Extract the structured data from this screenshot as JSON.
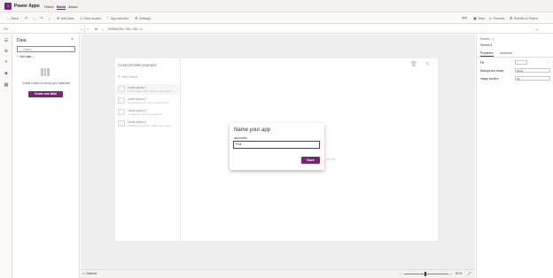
{
  "app": {
    "title": "Power Apps",
    "logo_glyph": "›"
  },
  "topnav": {
    "home": "Home",
    "build": "Build",
    "about": "About"
  },
  "cmdbar": {
    "back": "Back",
    "add_data": "Add data",
    "new_screen": "New screen",
    "app_checker": "App checker",
    "settings": "Settings",
    "app": "App",
    "save": "Save",
    "preview": "Preview",
    "publish": "Publish to Teams"
  },
  "formula": {
    "property": "Fill",
    "fx": "fx",
    "expression": "RGBA(255, 255, 255, 1)"
  },
  "data_panel": {
    "title": "Data",
    "search_placeholder": "Search",
    "add_data": "Add data",
    "empty_message": "Create a table to set up your database",
    "create_button": "Create new table"
  },
  "canvas": {
    "gallery_title": "CustomGallerySample",
    "new_record": "New record",
    "items": [
      {
        "title": "Lorem ipsum 1",
        "subtitle": "Lorem ipsum dolor sit amet, consectetur"
      },
      {
        "title": "Lorem ipsum 2",
        "subtitle": "Suspendisse elit metus, tincidunt quis"
      },
      {
        "title": "Lorem ipsum 3",
        "subtitle": "Ut pharetra a dolor ac vehicula"
      },
      {
        "title": "Lorem ipsum 4",
        "subtitle": "Vestibulum leo felis, fringilla nec et velit"
      }
    ],
    "hidden_text": "this list"
  },
  "right_panel": {
    "screen_label": "Screen",
    "screen_name": "Screen1",
    "tab_properties": "Properties",
    "tab_advanced": "Advanced",
    "fill_label": "Fill",
    "bg_image_label": "Background image",
    "bg_image_value": "None",
    "image_position_label": "Image position",
    "image_position_value": "Fit"
  },
  "bottom": {
    "screen": "Screen1",
    "zoom": "50 %"
  },
  "dialog": {
    "title": "Name your app",
    "label": "App name",
    "value": "Poll",
    "save": "Save"
  }
}
